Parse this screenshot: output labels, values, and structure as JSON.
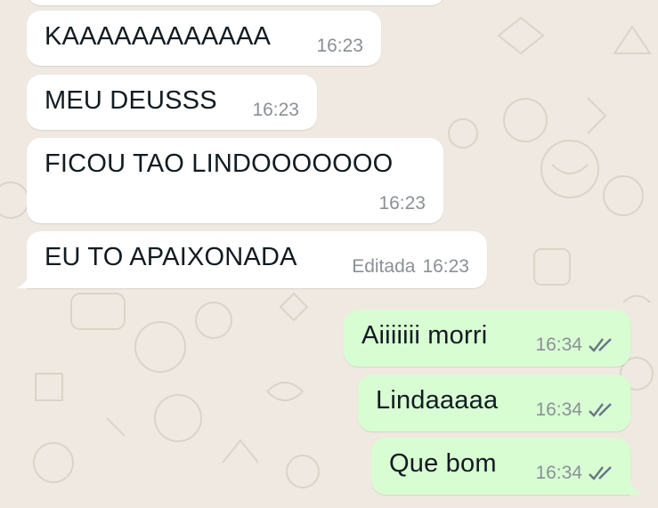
{
  "chat": {
    "incoming": [
      {
        "text": "KAAAAAAAAAAAA",
        "time": "16:23",
        "edited": ""
      },
      {
        "text": "MEU DEUSSS",
        "time": "16:23",
        "edited": ""
      },
      {
        "text": "FICOU TAO LINDOOOOOOO",
        "time": "16:23",
        "edited": ""
      },
      {
        "text": "EU TO APAIXONADA",
        "time": "16:23",
        "edited": "Editada"
      }
    ],
    "outgoing": [
      {
        "text": "Aiiiiiii morri",
        "time": "16:34",
        "status_icon": "double-check-icon"
      },
      {
        "text": "Lindaaaaa",
        "time": "16:34",
        "status_icon": "double-check-icon"
      },
      {
        "text": "Que bom",
        "time": "16:34",
        "status_icon": "double-check-icon"
      }
    ]
  },
  "colors": {
    "wallpaper": "#efe9e1",
    "incoming_bubble": "#ffffff",
    "outgoing_bubble": "#d9fdd3",
    "text": "#111b21",
    "meta": "#8a9095"
  }
}
